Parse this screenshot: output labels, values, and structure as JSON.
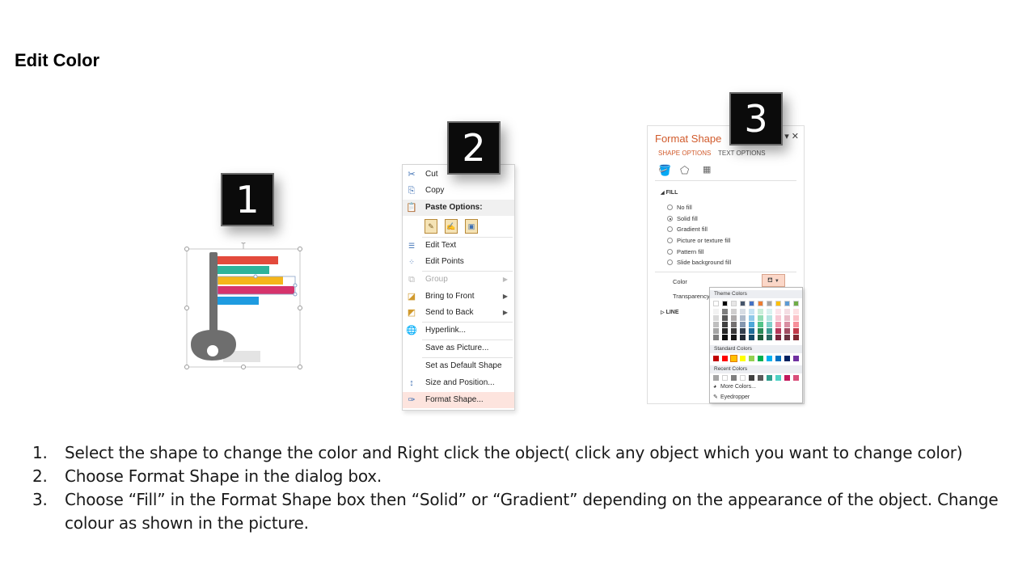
{
  "slide": {
    "title": "Edit Color"
  },
  "badges": {
    "step1": "1",
    "step2": "2",
    "step3": "3"
  },
  "context_menu": {
    "items": [
      {
        "label": "Cut",
        "icon": "scissors-icon",
        "enabled": true,
        "submenu": false
      },
      {
        "label": "Copy",
        "icon": "copy-icon",
        "enabled": true,
        "submenu": false
      },
      {
        "label": "Paste Options:",
        "icon": "clipboard-icon",
        "enabled": true,
        "submenu": false
      },
      {
        "label": "Edit Text",
        "icon": "edit-text-icon",
        "enabled": true,
        "submenu": false
      },
      {
        "label": "Edit Points",
        "icon": "edit-points-icon",
        "enabled": true,
        "submenu": false
      },
      {
        "label": "Group",
        "icon": "group-icon",
        "enabled": false,
        "submenu": true
      },
      {
        "label": "Bring to Front",
        "icon": "bring-to-front-icon",
        "enabled": true,
        "submenu": true
      },
      {
        "label": "Send to Back",
        "icon": "send-to-back-icon",
        "enabled": true,
        "submenu": true
      },
      {
        "label": "Hyperlink...",
        "icon": "hyperlink-icon",
        "enabled": true,
        "submenu": false
      },
      {
        "label": "Save as Picture...",
        "icon": "",
        "enabled": true,
        "submenu": false
      },
      {
        "label": "Set as Default Shape",
        "icon": "",
        "enabled": true,
        "submenu": false
      },
      {
        "label": "Size and Position...",
        "icon": "size-position-icon",
        "enabled": true,
        "submenu": false
      },
      {
        "label": "Format Shape...",
        "icon": "format-shape-icon",
        "enabled": true,
        "submenu": false,
        "highlighted": true
      }
    ]
  },
  "format_shape": {
    "title": "Format Shape",
    "tabs": [
      "SHAPE OPTIONS",
      "TEXT OPTIONS"
    ],
    "fill_section": "FILL",
    "line_section": "LINE",
    "fill_options": [
      {
        "label": "No fill",
        "selected": false
      },
      {
        "label": "Solid fill",
        "selected": true
      },
      {
        "label": "Gradient fill",
        "selected": false
      },
      {
        "label": "Picture or texture fill",
        "selected": false
      },
      {
        "label": "Pattern fill",
        "selected": false
      },
      {
        "label": "Slide background fill",
        "selected": false
      }
    ],
    "color_label": "Color",
    "transparency_label": "Transparency",
    "palette": {
      "theme_colors_label": "Theme Colors",
      "standard_colors_label": "Standard Colors",
      "recent_colors_label": "Recent Colors",
      "more_colors_label": "More Colors...",
      "eyedropper_label": "Eyedropper",
      "theme_top_row": [
        "#ffffff",
        "#000000",
        "#e7e6e6",
        "#44546a",
        "#4472c4",
        "#ed7d31",
        "#a5a5a5",
        "#ffc000",
        "#5b9bd5",
        "#70ad47"
      ],
      "theme_columns": [
        [
          "#f2f2f2",
          "#d9d9d9",
          "#bfbfbf",
          "#a6a6a6",
          "#808080"
        ],
        [
          "#7f7f7f",
          "#595959",
          "#404040",
          "#262626",
          "#0d0d0d"
        ],
        [
          "#d0cece",
          "#aeaaaa",
          "#757171",
          "#3a3838",
          "#171616"
        ],
        [
          "#d6dce4",
          "#adb9ca",
          "#8497b0",
          "#333f4f",
          "#222a35"
        ],
        [
          "#c5e3f3",
          "#8fc9e9",
          "#4fa8d9",
          "#1e6e9a",
          "#124966"
        ],
        [
          "#c9eed9",
          "#93ddb4",
          "#53c489",
          "#2a8a57",
          "#1c5c3a"
        ],
        [
          "#d9f2f0",
          "#b3e5e1",
          "#7fd1c9",
          "#3a9b91",
          "#276760"
        ],
        [
          "#fbe3e9",
          "#f7c7d3",
          "#ee93a8",
          "#b5385a",
          "#79253c"
        ],
        [
          "#f4dde3",
          "#e9bbc7",
          "#d98ea2",
          "#a14d63",
          "#6b3342"
        ],
        [
          "#fde0e3",
          "#fbc1c7",
          "#f78f9a",
          "#c23a4a",
          "#822731"
        ]
      ],
      "standard": [
        "#c00000",
        "#ff0000",
        "#ffc000",
        "#ffff00",
        "#92d050",
        "#00b050",
        "#00b0f0",
        "#0070c0",
        "#002060",
        "#7030a0"
      ],
      "recent": [
        "#a6a6a6",
        "#ffffff",
        "#7f7f7f",
        "#ffffff",
        "#404040",
        "#595959",
        "#2e9e8e",
        "#4fd1c5",
        "#c2185b",
        "#d94f7a"
      ]
    }
  },
  "instructions": [
    {
      "num": "1.",
      "text": "Select the shape to change the color and Right click the object( click any object which you want to change color)"
    },
    {
      "num": "2.",
      "text": "Choose Format Shape in the dialog box."
    },
    {
      "num": "3.",
      "text": "Choose “Fill” in the Format Shape box then “Solid” or “Gradient” depending on the appearance of the object. Change colour as shown in the picture."
    }
  ],
  "colors": {
    "accent": "#d15b2c",
    "bar_colors": [
      "#e34a3c",
      "#2eb39a",
      "#f5b51b",
      "#d6336c",
      "#1e9be0"
    ],
    "key_gray": "#6e6e6e"
  }
}
